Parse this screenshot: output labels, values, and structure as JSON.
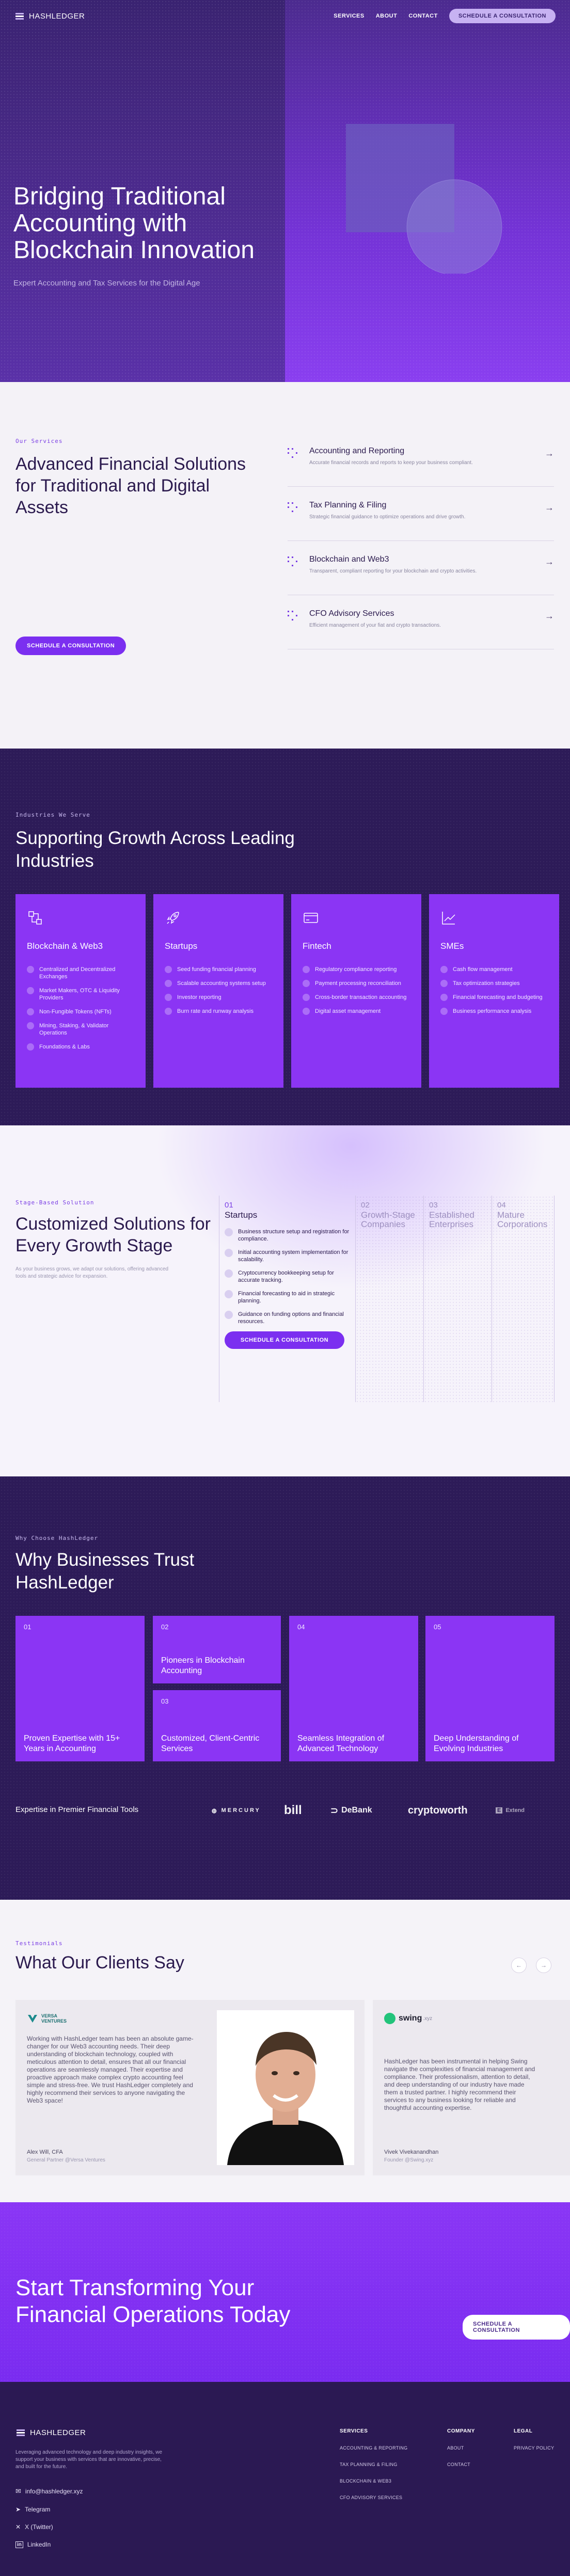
{
  "nav": {
    "logo": "HASHLEDGER",
    "links": [
      "SERVICES",
      "ABOUT",
      "CONTACT"
    ],
    "cta": "SCHEDULE A CONSULTATION"
  },
  "hero": {
    "title": "Bridging Traditional Accounting with Blockchain Innovation",
    "subtitle": "Expert Accounting and Tax Services for the Digital Age"
  },
  "services": {
    "eyebrow": "Our Services",
    "title": "Advanced Financial Solutions for Traditional and Digital Assets",
    "cta": "SCHEDULE A CONSULTATION",
    "items": [
      {
        "title": "Accounting and Reporting",
        "desc": "Accurate financial records and reports to keep your business compliant."
      },
      {
        "title": "Tax Planning & Filing",
        "desc": "Strategic financial guidance to optimize operations and drive growth."
      },
      {
        "title": "Blockchain and Web3",
        "desc": "Transparent, compliant reporting for your blockchain and crypto activities."
      },
      {
        "title": "CFO Advisory Services",
        "desc": "Efficient management of your fiat and crypto transactions."
      }
    ]
  },
  "industries": {
    "eyebrow": "Industries We Serve",
    "title": "Supporting Growth Across Leading Industries",
    "cards": [
      {
        "icon": "blockchain-icon",
        "title": "Blockchain & Web3",
        "items": [
          "Centralized and Decentralized Exchanges",
          "Market Makers, OTC & Liquidity Providers",
          "Non-Fungible Tokens (NFTs)",
          "Mining, Staking, & Validator Operations",
          "Foundations & Labs"
        ]
      },
      {
        "icon": "rocket-icon",
        "title": "Startups",
        "items": [
          "Seed funding financial planning",
          "Scalable accounting systems setup",
          "Investor reporting",
          "Burn rate and runway analysis"
        ]
      },
      {
        "icon": "card-icon",
        "title": "Fintech",
        "items": [
          "Regulatory compliance reporting",
          "Payment processing reconciliation",
          "Cross-border transaction accounting",
          "Digital asset management"
        ]
      },
      {
        "icon": "chart-icon",
        "title": "SMEs",
        "items": [
          "Cash flow management",
          "Tax optimization strategies",
          "Financial forecasting and budgeting",
          "Business performance analysis"
        ]
      }
    ]
  },
  "stages": {
    "eyebrow": "Stage-Based Solution",
    "title": "Customized Solutions for Every Growth Stage",
    "subtitle": "As your business grows, we adapt our solutions, offering advanced tools and strategic advice for expansion.",
    "cols": [
      {
        "num": "01",
        "title": "Startups",
        "items": [
          "Business structure setup and registration for compliance.",
          "Initial accounting system implementation for scalability.",
          "Cryptocurrency bookkeeping setup for accurate tracking.",
          "Financial forecasting to aid in strategic planning.",
          "Guidance on funding options and financial resources."
        ],
        "cta": "SCHEDULE A CONSULTATION"
      },
      {
        "num": "02",
        "title": "Growth-Stage Companies"
      },
      {
        "num": "03",
        "title": "Established Enterprises"
      },
      {
        "num": "04",
        "title": "Mature Corporations"
      }
    ]
  },
  "why": {
    "eyebrow": "Why Choose HashLedger",
    "title": "Why Businesses Trust HashLedger",
    "cards": [
      {
        "num": "01",
        "title": "Proven Expertise with 15+ Years in Accounting"
      },
      {
        "num": "02",
        "title": "Pioneers in Blockchain Accounting"
      },
      {
        "num": "03",
        "title": "Customized, Client-Centric Services"
      },
      {
        "num": "04",
        "title": "Seamless Integration of Advanced Technology"
      },
      {
        "num": "05",
        "title": "Deep Understanding of Evolving Industries"
      }
    ],
    "tools_label": "Expertise in Premier Financial Tools",
    "tools": [
      "MERCURY",
      "bill",
      "DeBank",
      "cryptoworth",
      "Extend"
    ]
  },
  "testimonials": {
    "eyebrow": "Testimonials",
    "title": "What Our Clients Say",
    "items": [
      {
        "logo": "VERSA VENTURES",
        "quote": "Working with HashLedger team has been an absolute game-changer for our Web3 accounting needs. Their deep understanding of blockchain technology, coupled with meticulous attention to detail, ensures that all our financial operations are seamlessly managed. Their expertise and proactive approach make complex crypto accounting feel simple and stress-free. We trust HashLedger completely and highly recommend their services to anyone navigating the Web3 space!",
        "name": "Alex Will, CFA",
        "role": "General Partner @Versa Ventures"
      },
      {
        "logo": "swing",
        "logo_suffix": ".xyz",
        "quote": "HashLedger has been instrumental in helping Swing navigate the complexities of financial management and compliance. Their professionalism, attention to detail, and deep understanding of our industry have made them a trusted partner. I highly recommend their services to any business looking for reliable and thoughtful accounting expertise.",
        "name": "Vivek Vivekanandhan",
        "role": "Founder @Swing.xyz"
      }
    ]
  },
  "cta": {
    "title": "Start Transforming Your Financial Operations Today",
    "button": "SCHEDULE A CONSULTATION"
  },
  "footer": {
    "logo": "HASHLEDGER",
    "about": "Leveraging advanced technology and deep industry insights, we support your business with services that are innovative, precise, and built for the future.",
    "contacts": [
      "info@hashledger.xyz",
      "Telegram",
      "X (Twitter)",
      "LinkedIn"
    ],
    "services_heading": "SERVICES",
    "services": [
      "ACCOUNTING & REPORTING",
      "TAX PLANNING & FILING",
      "BLOCKCHAIN & WEB3",
      "CFO ADVISORY SERVICES"
    ],
    "company_heading": "COMPANY",
    "company": [
      "ABOUT",
      "CONTACT"
    ],
    "legal_heading": "LEGAL",
    "legal": [
      "PRIVACY POLICY"
    ]
  }
}
